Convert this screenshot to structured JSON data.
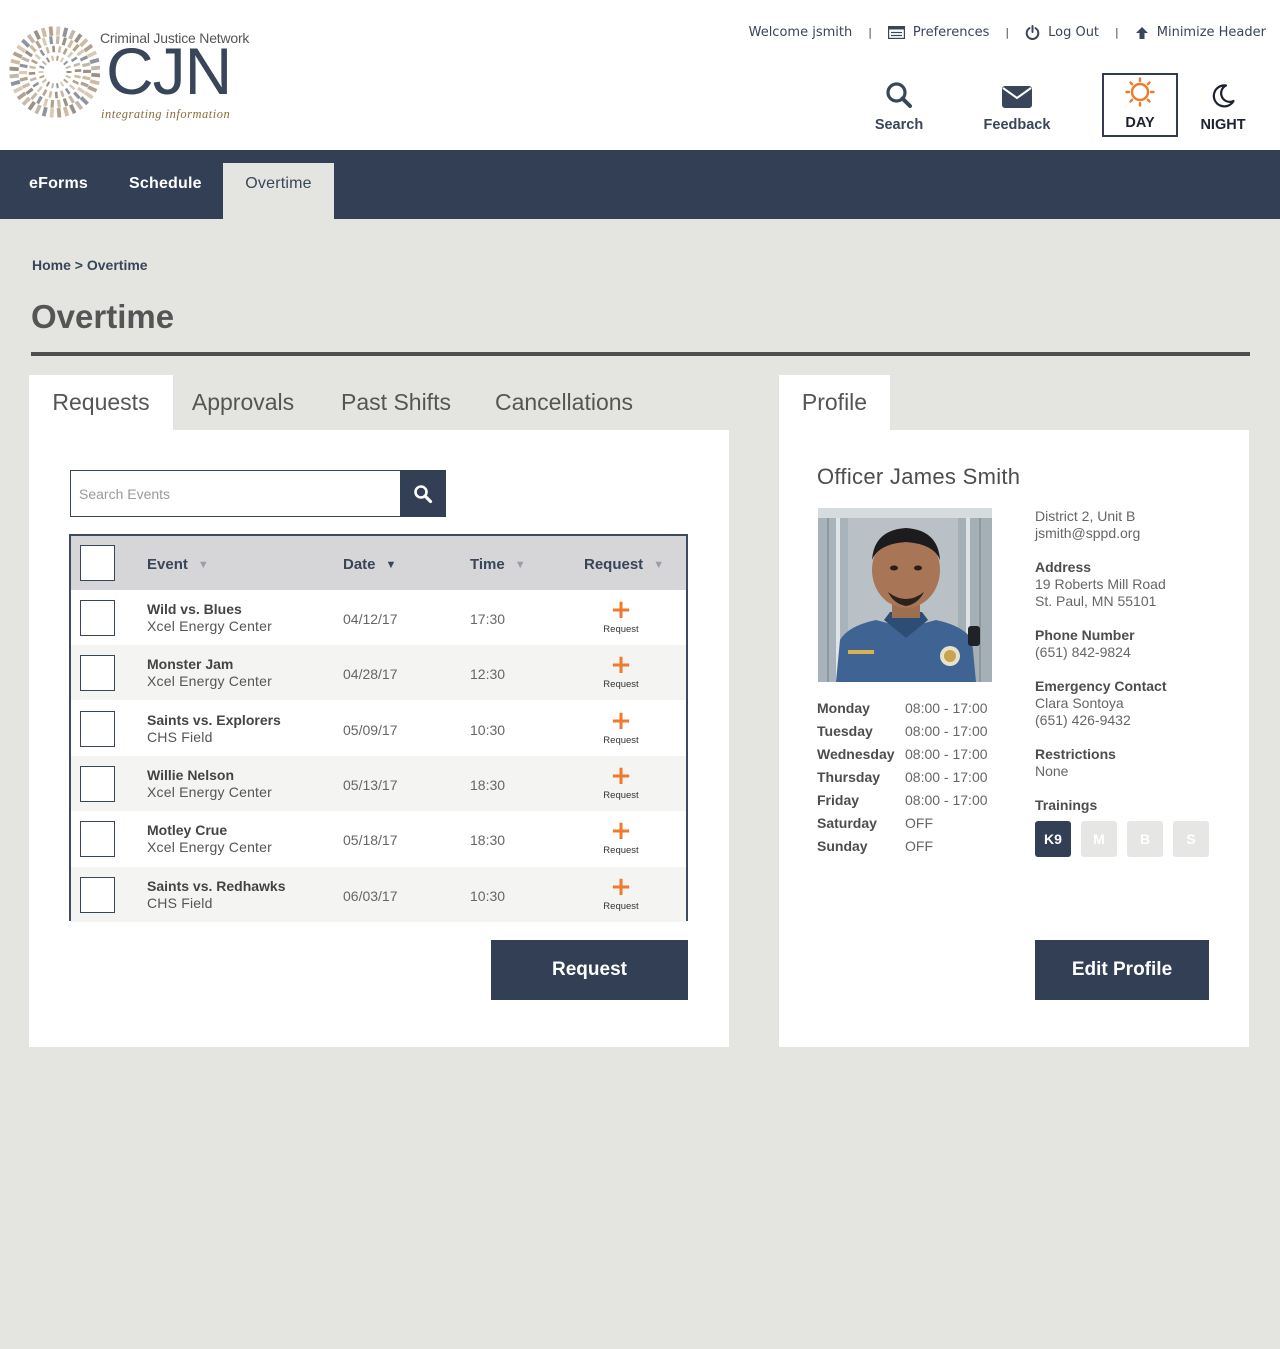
{
  "header": {
    "logo": {
      "network": "Criminal Justice Network",
      "initials": "CJN",
      "tagline": "integrating information"
    },
    "welcome": "Welcome jsmith",
    "preferences": "Preferences",
    "logout": "Log Out",
    "minimize": "Minimize Header",
    "search_label": "Search",
    "feedback_label": "Feedback",
    "day_label": "DAY",
    "night_label": "NIGHT",
    "accent": "#ef7a2d",
    "brand": "#333f54"
  },
  "nav": {
    "items": [
      {
        "label": "eForms"
      },
      {
        "label": "Schedule"
      },
      {
        "label": "Overtime",
        "active": true
      }
    ]
  },
  "breadcrumb": {
    "home": "Home",
    "sep": ">",
    "current": "Overtime"
  },
  "page_title": "Overtime",
  "tabs": [
    {
      "label": "Requests",
      "active": true
    },
    {
      "label": "Approvals"
    },
    {
      "label": "Past Shifts"
    },
    {
      "label": "Cancellations"
    }
  ],
  "search": {
    "placeholder": "Search Events",
    "value": ""
  },
  "table": {
    "headers": {
      "event": "Event",
      "date": "Date",
      "time": "Time",
      "request": "Request"
    },
    "sorted_by": "Date",
    "rows": [
      {
        "event": "Wild vs. Blues",
        "venue": "Xcel Energy Center",
        "date": "04/12/17",
        "time": "17:30",
        "request": "Request"
      },
      {
        "event": "Monster Jam",
        "venue": "Xcel Energy Center",
        "date": "04/28/17",
        "time": "12:30",
        "request": "Request"
      },
      {
        "event": "Saints vs. Explorers",
        "venue": "CHS Field",
        "date": "05/09/17",
        "time": "10:30",
        "request": "Request"
      },
      {
        "event": "Willie Nelson",
        "venue": "Xcel Energy Center",
        "date": "05/13/17",
        "time": "18:30",
        "request": "Request"
      },
      {
        "event": "Motley Crue",
        "venue": "Xcel Energy Center",
        "date": "05/18/17",
        "time": "18:30",
        "request": "Request"
      },
      {
        "event": "Saints vs. Redhawks",
        "venue": "CHS Field",
        "date": "06/03/17",
        "time": "10:30",
        "request": "Request"
      }
    ]
  },
  "request_button": "Request",
  "profile": {
    "tab": "Profile",
    "name": "Officer James Smith",
    "unit": "District 2, Unit B",
    "email": "jsmith@sppd.org",
    "address_label": "Address",
    "address_line1": "19 Roberts Mill Road",
    "address_line2": "St. Paul, MN 55101",
    "phone_label": "Phone Number",
    "phone": "(651) 842-9824",
    "emergency_label": "Emergency Contact",
    "emergency_name": "Clara Sontoya",
    "emergency_phone": "(651) 426-9432",
    "restrictions_label": "Restrictions",
    "restrictions": "None",
    "trainings_label": "Trainings",
    "trainings": [
      {
        "code": "K9",
        "active": true
      },
      {
        "code": "M",
        "active": false
      },
      {
        "code": "B",
        "active": false
      },
      {
        "code": "S",
        "active": false
      }
    ],
    "schedule": [
      {
        "day": "Monday",
        "hours": "08:00 - 17:00"
      },
      {
        "day": "Tuesday",
        "hours": "08:00 - 17:00"
      },
      {
        "day": "Wednesday",
        "hours": "08:00 - 17:00"
      },
      {
        "day": "Thursday",
        "hours": "08:00 - 17:00"
      },
      {
        "day": "Friday",
        "hours": "08:00 - 17:00"
      },
      {
        "day": "Saturday",
        "hours": "OFF"
      },
      {
        "day": "Sunday",
        "hours": "OFF"
      }
    ],
    "edit_button": "Edit Profile"
  }
}
